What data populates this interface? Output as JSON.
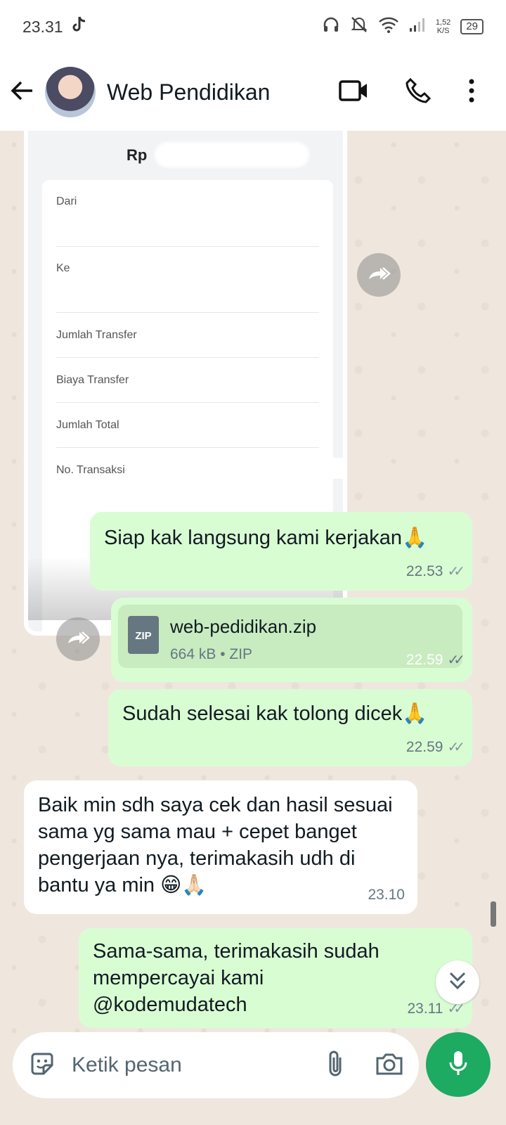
{
  "status_bar": {
    "time": "23.31",
    "speed_value": "1,52",
    "speed_unit": "K/S",
    "battery": "29"
  },
  "header": {
    "contact_name": "Web Pendidikan"
  },
  "receipt": {
    "currency": "Rp",
    "fields": [
      "Dari",
      "Ke",
      "Jumlah Transfer",
      "Biaya Transfer",
      "Jumlah Total",
      "No. Transaksi"
    ]
  },
  "messages": [
    {
      "text": "Siap kak langsung kami kerjakan🙏",
      "time": "22.53"
    },
    {
      "file_name": "web-pedidikan.zip",
      "file_meta": "664 kB • ZIP",
      "file_type": "ZIP",
      "time": "22.59"
    },
    {
      "text": "Sudah selesai kak tolong dicek🙏",
      "time": "22.59"
    },
    {
      "text": "Baik min sdh saya cek dan hasil sesuai sama yg sama mau + cepet banget pengerjaan nya, terimakasih udh di bantu ya min 😁🙏🏻",
      "time": "23.10"
    },
    {
      "text": "Sama-sama, terimakasih sudah mempercayai kami @kodemudatech",
      "time": "23.11"
    }
  ],
  "composer": {
    "placeholder": "Ketik pesan"
  },
  "colors": {
    "outgoing_bubble": "#d9fdd3",
    "incoming_bubble": "#ffffff",
    "send_button": "#1daa61",
    "chat_background": "#efe7de"
  }
}
